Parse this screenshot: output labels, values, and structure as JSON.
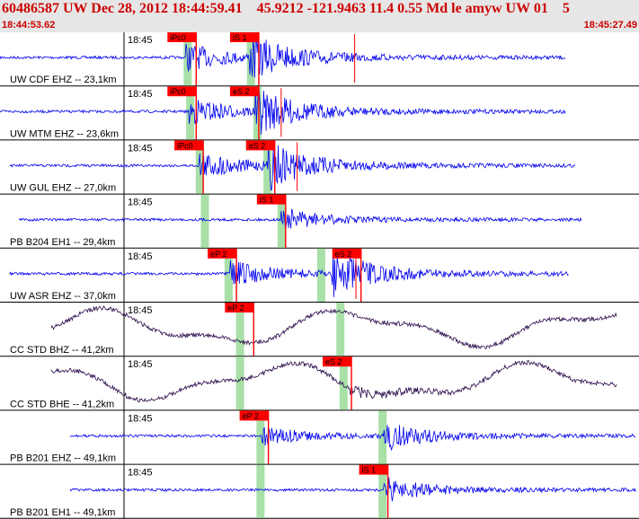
{
  "header": {
    "title": "60486587 UW Dec 28, 2012 18:44:59.41    45.9212 -121.9463 11.4 0.55 Md le amyw UW 01    5",
    "start_time": "18:44:53.62",
    "end_time": "18:45:27.49"
  },
  "time_tick_label": "18:45",
  "colors": {
    "wave_blue": "#0000ee",
    "wave_dark": "#2a0a4a",
    "pick_red": "#ff0000",
    "pick_band": "#a8e0a8",
    "header_red": "#cc0000"
  },
  "traces": [
    {
      "label": "UW CDF EHZ -- 23,1km",
      "color": "blue",
      "start": 0.0,
      "end": 0.885,
      "onsets": [
        0.29,
        0.39
      ],
      "amp": 1.0,
      "bands": [
        0.293,
        0.392
      ],
      "picks": [
        {
          "text": "iPc0",
          "pos": 0.262
        },
        {
          "text": "iS 1",
          "pos": 0.36
        }
      ],
      "extra": [
        0.555
      ]
    },
    {
      "label": "UW MTM EHZ -- 23,6km",
      "color": "blue",
      "start": 0.0,
      "end": 0.885,
      "onsets": [
        0.295,
        0.4
      ],
      "amp": 1.0,
      "bands": [
        0.297,
        0.402
      ],
      "picks": [
        {
          "text": "iPc0",
          "pos": 0.262
        },
        {
          "text": "eS 2",
          "pos": 0.36
        }
      ],
      "extra": [
        0.44
      ]
    },
    {
      "label": "UW GUL EHZ -- 27,0km",
      "color": "blue",
      "start": 0.015,
      "end": 0.9,
      "onsets": [
        0.31,
        0.42
      ],
      "amp": 1.0,
      "bands": [
        0.312,
        0.418
      ],
      "picks": [
        {
          "text": "iPc0",
          "pos": 0.273
        },
        {
          "text": "eS 2",
          "pos": 0.385
        }
      ],
      "extra": [
        0.465
      ]
    },
    {
      "label": "PB B204 EH1 -- 29,4km",
      "color": "blue",
      "start": 0.03,
      "end": 0.91,
      "onsets": [
        0.44
      ],
      "amp": 0.8,
      "bands": [
        0.32,
        0.44
      ],
      "picks": [
        {
          "text": "iS 1",
          "pos": 0.402
        }
      ],
      "extra": []
    },
    {
      "label": "UW ASR EHZ -- 37,0km",
      "color": "blue",
      "start": 0.015,
      "end": 0.89,
      "onsets": [
        0.36,
        0.52
      ],
      "amp": 1.0,
      "bands": [
        0.357,
        0.502
      ],
      "picks": [
        {
          "text": "eP 2",
          "pos": 0.325
        },
        {
          "text": "eS 2",
          "pos": 0.52
        }
      ],
      "extra": [
        0.557
      ]
    },
    {
      "label": "CC STD BHZ -- 41,2km",
      "color": "dark",
      "start": 0.08,
      "end": 0.965,
      "onsets": [],
      "amp": 0.6,
      "bands": [
        0.375,
        0.532
      ],
      "picks": [
        {
          "text": "eP 2",
          "pos": 0.352
        }
      ],
      "extra": []
    },
    {
      "label": "CC STD BHE -- 41,2km",
      "color": "dark",
      "start": 0.08,
      "end": 0.965,
      "onsets": [
        0.545
      ],
      "amp": 0.6,
      "bands": [
        0.375,
        0.537
      ],
      "picks": [
        {
          "text": "eS 2",
          "pos": 0.505
        }
      ],
      "extra": []
    },
    {
      "label": "PB B201 EHZ -- 49,1km",
      "color": "blue",
      "start": 0.11,
      "end": 0.995,
      "onsets": [
        0.41,
        0.6
      ],
      "amp": 0.7,
      "bands": [
        0.407,
        0.598
      ],
      "picks": [
        {
          "text": "eP 2",
          "pos": 0.375
        }
      ],
      "extra": []
    },
    {
      "label": "PB B201 EH1 -- 49,1km",
      "color": "blue",
      "start": 0.11,
      "end": 0.995,
      "onsets": [
        0.6
      ],
      "amp": 0.9,
      "bands": [
        0.407,
        0.598
      ],
      "picks": [
        {
          "text": "iS 1",
          "pos": 0.562
        }
      ],
      "extra": []
    }
  ]
}
